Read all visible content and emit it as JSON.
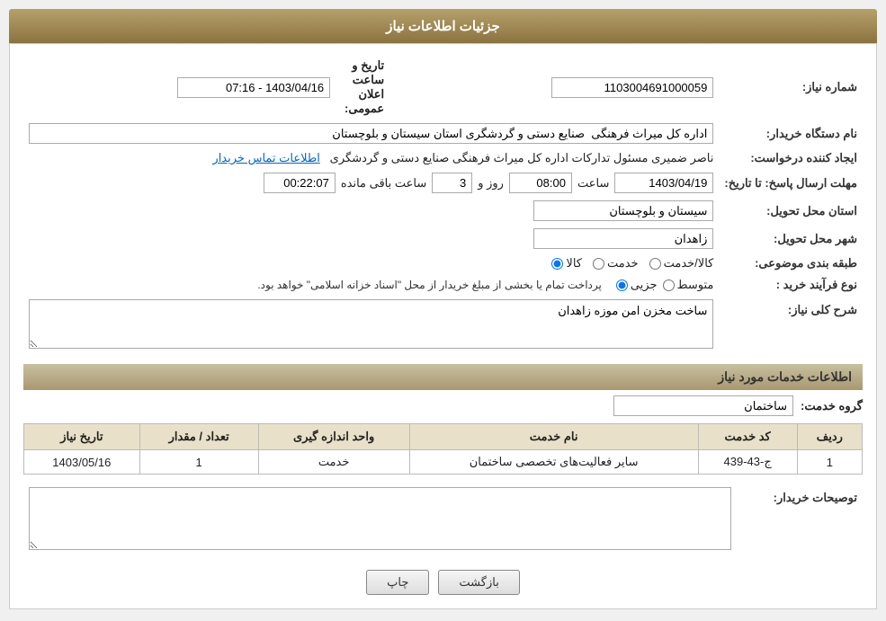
{
  "header": {
    "title": "جزئیات اطلاعات نیاز"
  },
  "fields": {
    "need_number_label": "شماره نیاز:",
    "need_number_value": "1103004691000059",
    "announcement_datetime_label": "تاریخ و ساعت اعلان عمومی:",
    "announcement_datetime_value": "1403/04/16 - 07:16",
    "buyer_org_label": "نام دستگاه خریدار:",
    "buyer_org_value": "اداره کل میراث فرهنگی  صنایع دستی و گردشگری استان سیستان و بلوچستان",
    "creator_label": "ایجاد کننده درخواست:",
    "creator_value": "ناصر ضمیری مسئول تدارکات اداره کل میراث فرهنگی  صنایع دستی و گردشگری",
    "creator_link": "اطلاعات تماس خریدار",
    "response_deadline_label": "مهلت ارسال پاسخ: تا تاریخ:",
    "response_date": "1403/04/19",
    "response_time_label": "ساعت",
    "response_time": "08:00",
    "response_days_label": "روز و",
    "response_days": "3",
    "response_remaining_label": "ساعت باقی مانده",
    "response_remaining": "00:22:07",
    "delivery_province_label": "استان محل تحویل:",
    "delivery_province_value": "سیستان و بلوچستان",
    "delivery_city_label": "شهر محل تحویل:",
    "delivery_city_value": "زاهدان",
    "category_label": "طبقه بندی موضوعی:",
    "category_kala": "کالا",
    "category_khadamat": "خدمت",
    "category_kala_khadamat": "کالا/خدمت",
    "purchase_type_label": "نوع فرآیند خرید :",
    "purchase_type_jozvi": "جزیی",
    "purchase_type_motavasset": "متوسط",
    "purchase_type_note": "پرداخت تمام یا بخشی از مبلغ خریدار از محل \"اسناد خزانه اسلامی\" خواهد بود.",
    "need_description_label": "شرح کلی نیاز:",
    "need_description_value": "ساخت مخزن امن موزه زاهدان",
    "services_section_label": "اطلاعات خدمات مورد نیاز",
    "service_group_label": "گروه خدمت:",
    "service_group_value": "ساختمان",
    "table_headers": {
      "row_num": "ردیف",
      "service_code": "کد خدمت",
      "service_name": "نام خدمت",
      "unit": "واحد اندازه گیری",
      "quantity": "تعداد / مقدار",
      "need_date": "تاریخ نیاز"
    },
    "table_rows": [
      {
        "row_num": "1",
        "service_code": "ج-43-439",
        "service_name": "سایر فعالیت‌های تخصصی ساختمان",
        "unit": "خدمت",
        "quantity": "1",
        "need_date": "1403/05/16"
      }
    ],
    "buyer_description_label": "توصیحات خریدار:",
    "btn_print": "چاپ",
    "btn_back": "بازگشت"
  }
}
